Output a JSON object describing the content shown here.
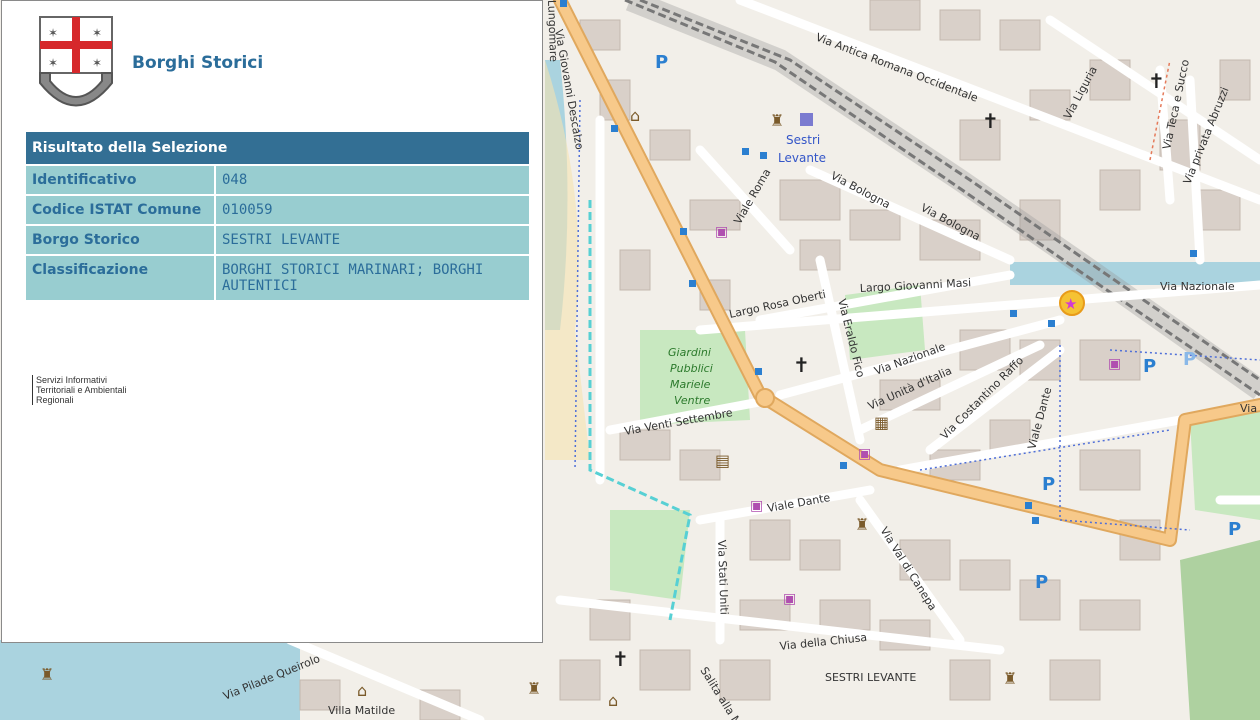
{
  "app": {
    "title": "Borghi Storici",
    "logo_icon": "liguria-crest-icon"
  },
  "result": {
    "header": "Risultato della Selezione",
    "rows": [
      {
        "key": "Identificativo",
        "value": "048"
      },
      {
        "key": "Codice ISTAT Comune",
        "value": "010059"
      },
      {
        "key": "Borgo Storico",
        "value": "SESTRI LEVANTE"
      },
      {
        "key": "Classificazione",
        "value": "BORGHI STORICI MARINARI; BORGHI AUTENTICI"
      }
    ]
  },
  "credit": {
    "line1": "Servizi Informativi",
    "line2": "Territoriali e Ambientali",
    "line3": "Regionali"
  },
  "map": {
    "streets": [
      "Via Antica Romana Occidentale",
      "Via Liguria",
      "Via Teca e Succo",
      "Via privata Abruzzi",
      "Via Bologna",
      "Via Bologna",
      "Viale Roma",
      "Largo Giovanni Masi",
      "Largo Rosa Oberti",
      "Via Nazionale",
      "Via Nazionale",
      "Via Eraldo Fico",
      "Via Unità d'Italia",
      "Via Costantino Raffo",
      "Viale Dante",
      "Viale Dante",
      "Via Venti Settembre",
      "Via Stati Uniti",
      "Via Val di Canepa",
      "Via della Chiusa",
      "Via Pilade Queirolo",
      "Salita alla M",
      "Via",
      "Via Giovanni Descalzo",
      "Lungomare"
    ],
    "station_label_1": "Sestri",
    "station_label_2": "Levante",
    "park_label": [
      "Giardini",
      "Pubblici",
      "Mariele",
      "Ventre"
    ],
    "town_label": "SESTRI LEVANTE",
    "villa_label": "Villa Matilde",
    "parking_symbol": "P",
    "colors": {
      "primary_road": "#f7c98a",
      "primary_road_edge": "#e0a85e",
      "water": "#aad3df",
      "park": "#c8e8c0",
      "header": "#336f94",
      "cell": "#98cdd0",
      "text_blue": "#2b6d9a"
    }
  }
}
